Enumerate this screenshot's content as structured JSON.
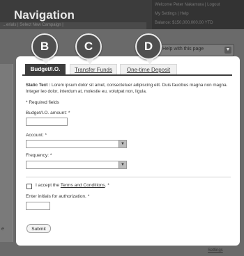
{
  "app": {
    "title": "Navigation",
    "breadcrumb": "...erials  |  Select New Campaign  |",
    "top_right_lines": [
      "Welcome Peter Nakamura  |  Logout",
      "My Settings  |  Help",
      "Balance: $150,000,000.00 YTD"
    ],
    "help_select": "Help with this page",
    "left_char": "e",
    "settings_link": "Settings"
  },
  "callouts": [
    "B",
    "C",
    "D"
  ],
  "tabs": {
    "budget": "Budget/I.O.",
    "transfer": "Transfer Funds",
    "deposit": "One-time Deposit"
  },
  "form": {
    "static_label": "Static Text :",
    "static_text": "Lorem ipsum dolor sit amet, consectetuer adipiscing elit. Duis faucibus magna non magna. Integer leo dolor, interdum at, molestie eu, volutpat non, ligula.",
    "required_note": "* Required fields",
    "amount_label": "Budget/I.O. amount: *",
    "amount_value": "",
    "account_label": "Account: *",
    "account_value": "",
    "frequency_label": "Frequency: *",
    "frequency_value": "",
    "accept_prefix": "I accept the ",
    "terms_link": "Terms and Conditions",
    "accept_suffix": ". *",
    "initials_label": "Enter initials for authorization. *",
    "initials_value": "",
    "submit_label": "Submit"
  },
  "colors": {
    "overlay": "#5e5e5e",
    "tab_active": "#3d3d3d",
    "callout": "#4f4f4f"
  }
}
